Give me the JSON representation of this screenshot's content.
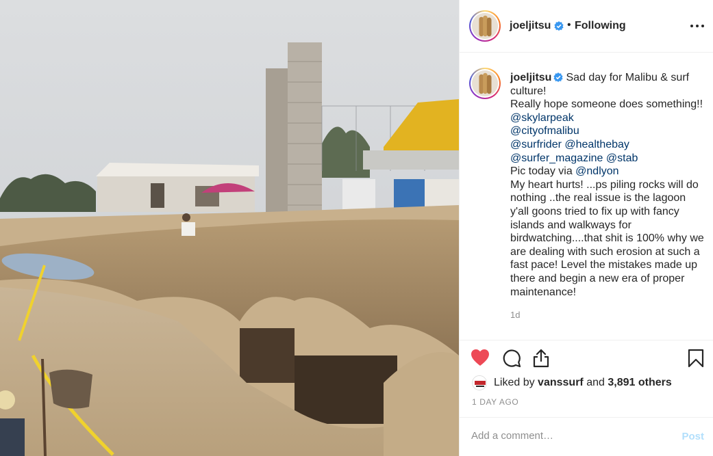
{
  "post": {
    "image_description_icon": "photo",
    "author": {
      "username": "joeljitsu",
      "verified_icon": "verified-badge-icon",
      "separator": "•",
      "follow_status": "Following"
    },
    "caption": {
      "username": "joeljitsu",
      "segments": [
        {
          "type": "text",
          "text": "Sad day for Malibu & surf culture!"
        },
        {
          "type": "text",
          "text": "Really hope someone does something!! "
        },
        {
          "type": "mention",
          "text": "@skylarpeak"
        },
        {
          "type": "mention",
          "text": "@cityofmalibu"
        },
        {
          "type": "mention",
          "text": "@surfrider"
        },
        {
          "type": "mention",
          "text": "@healthebay"
        },
        {
          "type": "mention",
          "text": "@surfer_magazine"
        },
        {
          "type": "mention",
          "text": "@stab"
        },
        {
          "type": "text",
          "text": "Pic today via "
        },
        {
          "type": "mention",
          "text": "@ndlyon"
        },
        {
          "type": "text",
          "text": "My heart hurts! ...ps piling rocks will do nothing ..the real issue is the lagoon y'all goons tried to fix up with fancy islands and walkways for birdwatching....that shit is 100% why we are dealing with such erosion at such a fast pace! Level the mistakes made up there and begin a new era of proper maintenance!"
        }
      ],
      "time_ago": "1d"
    },
    "actions": {
      "like_icon": "heart-filled-icon",
      "comment_icon": "comment-icon",
      "share_icon": "share-icon",
      "save_icon": "bookmark-icon",
      "like_color": "#ed4956"
    },
    "likes": {
      "prefix": "Liked by",
      "liked_by_user": "vanssurf",
      "connector": "and",
      "others": "3,891 others"
    },
    "date": "1 DAY AGO",
    "comment": {
      "placeholder": "Add a comment…",
      "post_label": "Post"
    }
  }
}
